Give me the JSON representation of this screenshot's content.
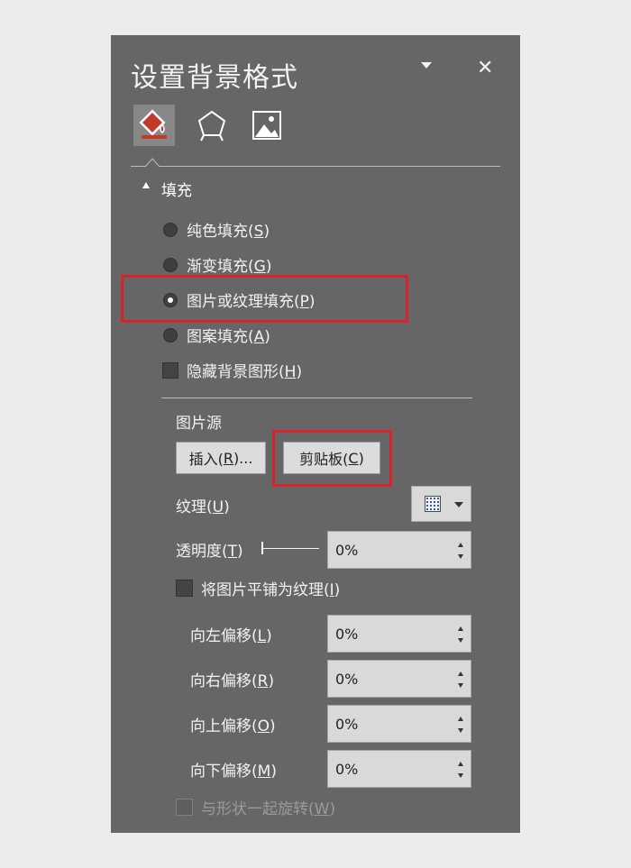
{
  "pane": {
    "title": "设置背景格式",
    "tabs": [
      {
        "icon": "fill-bucket-icon",
        "active": true
      },
      {
        "icon": "pentagon-effects-icon",
        "active": false
      },
      {
        "icon": "picture-icon",
        "active": false
      }
    ]
  },
  "fill_section": {
    "title": "填充",
    "options": [
      {
        "text": "纯色填充(",
        "key": "S",
        "end": ")",
        "checked": false
      },
      {
        "text": "渐变填充(",
        "key": "G",
        "end": ")",
        "checked": false
      },
      {
        "text": "图片或纹理填充(",
        "key": "P",
        "end": ")",
        "checked": true
      },
      {
        "text": "图案填充(",
        "key": "A",
        "end": ")",
        "checked": false
      }
    ],
    "hide_bg": {
      "text": "隐藏背景图形(",
      "key": "H",
      "end": ")",
      "checked": false
    }
  },
  "picture_source": {
    "title": "图片源",
    "insert": {
      "text": "插入(",
      "key": "R",
      "end": ")..."
    },
    "clipboard": {
      "text": "剪贴板(",
      "key": "C",
      "end": ")"
    }
  },
  "texture": {
    "text": "纹理(",
    "key": "U",
    "end": ")"
  },
  "transparency": {
    "text": "透明度(",
    "key": "T",
    "end": ")",
    "value": "0%",
    "level": 0
  },
  "tile": {
    "text": "将图片平铺为纹理(",
    "key": "I",
    "end": ")",
    "checked": false
  },
  "offsets": [
    {
      "text": "向左偏移(",
      "key": "L",
      "end": ")",
      "value": "0%"
    },
    {
      "text": "向右偏移(",
      "key": "R",
      "end": ")",
      "value": "0%"
    },
    {
      "text": "向上偏移(",
      "key": "O",
      "end": ")",
      "value": "0%"
    },
    {
      "text": "向下偏移(",
      "key": "M",
      "end": ")",
      "value": "0%"
    }
  ],
  "rotate": {
    "text": "与形状一起旋转(",
    "key": "W",
    "end": ")",
    "checked": false,
    "enabled": false
  },
  "colors": {
    "panel": "#666666",
    "highlight": "#d9222a",
    "fill_icon": "#c0392b"
  }
}
